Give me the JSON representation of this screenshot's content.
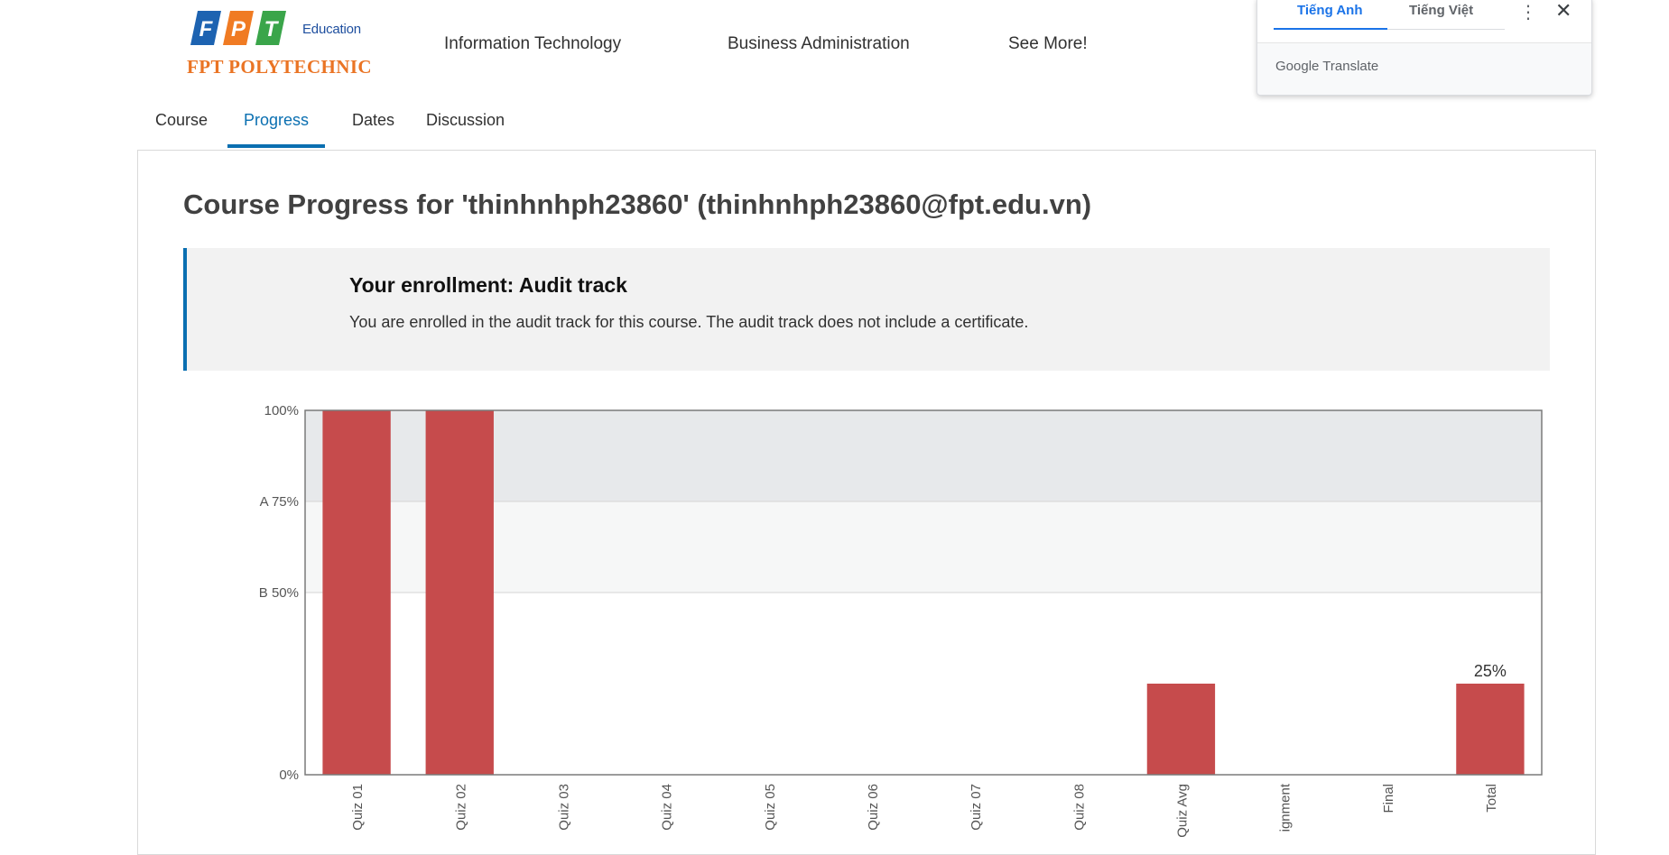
{
  "header": {
    "logo": {
      "edu_label": "Education",
      "brand": "FPT POLYTECHNIC",
      "mark_letters": [
        "F",
        "P",
        "T"
      ]
    },
    "nav": [
      "Information Technology",
      "Business Administration",
      "See More!"
    ]
  },
  "tabs": [
    {
      "label": "Course",
      "active": false
    },
    {
      "label": "Progress",
      "active": true
    },
    {
      "label": "Dates",
      "active": false
    },
    {
      "label": "Discussion",
      "active": false
    }
  ],
  "translate_popup": {
    "languages": [
      "Tiếng Anh",
      "Tiếng Việt"
    ],
    "selected": "Tiếng Anh",
    "brand_google": "Google",
    "brand_translate": "Translate",
    "menu_icon": "more-vert-icon",
    "close_icon": "close-icon"
  },
  "progress": {
    "title": "Course Progress for 'thinhnhph23860' (thinhnhph23860@fpt.edu.vn)",
    "enrollment_heading": "Your enrollment: Audit track",
    "enrollment_text": "You are enrolled in the audit track for this course. The audit track does not include a certificate."
  },
  "chart_data": {
    "type": "bar",
    "categories": [
      "Quiz 01",
      "Quiz 02",
      "Quiz 03",
      "Quiz 04",
      "Quiz 05",
      "Quiz 06",
      "Quiz 07",
      "Quiz 08",
      "Quiz Avg",
      "ignment",
      "Final",
      "Total"
    ],
    "values": [
      100,
      100,
      0,
      0,
      0,
      0,
      0,
      0,
      25,
      0,
      0,
      25
    ],
    "ylim": [
      0,
      100
    ],
    "y_ticks": [
      {
        "value": 100,
        "label": "100%"
      },
      {
        "value": 75,
        "label": "A 75%"
      },
      {
        "value": 50,
        "label": "B 50%"
      },
      {
        "value": 0,
        "label": "0%"
      }
    ],
    "grade_bands": [
      {
        "from": 75,
        "to": 100,
        "color": "#e7e9eb"
      },
      {
        "from": 50,
        "to": 75,
        "color": "#f6f7f7"
      }
    ],
    "data_labels": [
      {
        "category": "Total",
        "label": "25%"
      }
    ],
    "bar_color": "#c64b4c",
    "grid": true
  }
}
